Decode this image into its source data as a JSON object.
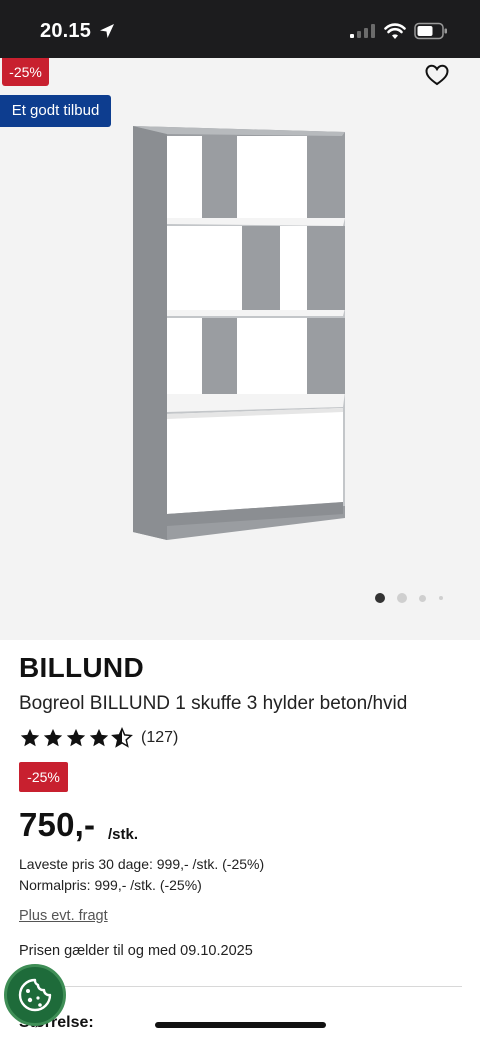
{
  "status_bar": {
    "time": "20.15",
    "icons": [
      "location-arrow-icon",
      "signal-icon",
      "wifi-icon",
      "battery-icon"
    ]
  },
  "gallery": {
    "discount_badge": "-25%",
    "offer_badge": "Et godt tilbud",
    "wishlist_icon": "heart-outline-icon",
    "carousel": {
      "total": 4,
      "active": 1
    }
  },
  "product": {
    "brand": "BILLUND",
    "title": "Bogreol BILLUND 1 skuffe 3 hylder beton/hvid",
    "rating": {
      "stars": 4.5,
      "count": "(127)"
    },
    "discount_badge": "-25%",
    "price": "750,-",
    "price_unit": "/stk.",
    "lowest_price": "Laveste pris 30 dage: 999,- /stk. (-25%)",
    "normal_price": "Normalpris: 999,- /stk. (-25%)",
    "shipping_link": "Plus evt. fragt",
    "validity": "Prisen gælder til og med 09.10.2025",
    "size_label": "Størrelse:"
  },
  "colors": {
    "discount_red": "#c8202f",
    "offer_blue": "#0d3d8f",
    "cookie_green": "#1e6b3a"
  }
}
